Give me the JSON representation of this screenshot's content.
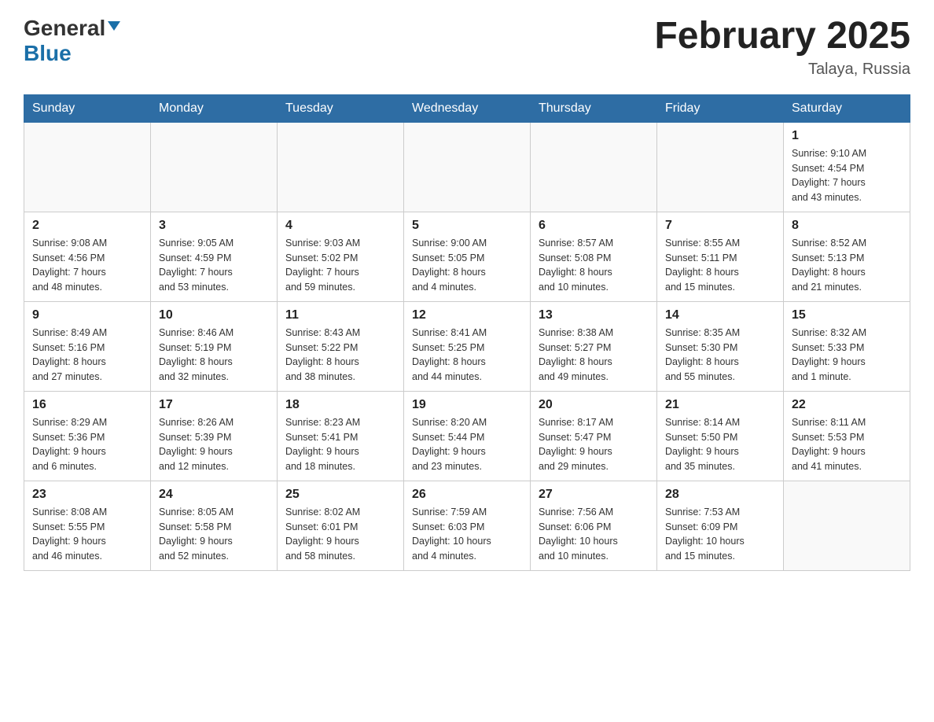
{
  "header": {
    "logo": {
      "general": "General",
      "blue": "Blue",
      "triangle": true
    },
    "title": "February 2025",
    "location": "Talaya, Russia"
  },
  "days_of_week": [
    "Sunday",
    "Monday",
    "Tuesday",
    "Wednesday",
    "Thursday",
    "Friday",
    "Saturday"
  ],
  "weeks": [
    [
      {
        "day": "",
        "info": ""
      },
      {
        "day": "",
        "info": ""
      },
      {
        "day": "",
        "info": ""
      },
      {
        "day": "",
        "info": ""
      },
      {
        "day": "",
        "info": ""
      },
      {
        "day": "",
        "info": ""
      },
      {
        "day": "1",
        "info": "Sunrise: 9:10 AM\nSunset: 4:54 PM\nDaylight: 7 hours\nand 43 minutes."
      }
    ],
    [
      {
        "day": "2",
        "info": "Sunrise: 9:08 AM\nSunset: 4:56 PM\nDaylight: 7 hours\nand 48 minutes."
      },
      {
        "day": "3",
        "info": "Sunrise: 9:05 AM\nSunset: 4:59 PM\nDaylight: 7 hours\nand 53 minutes."
      },
      {
        "day": "4",
        "info": "Sunrise: 9:03 AM\nSunset: 5:02 PM\nDaylight: 7 hours\nand 59 minutes."
      },
      {
        "day": "5",
        "info": "Sunrise: 9:00 AM\nSunset: 5:05 PM\nDaylight: 8 hours\nand 4 minutes."
      },
      {
        "day": "6",
        "info": "Sunrise: 8:57 AM\nSunset: 5:08 PM\nDaylight: 8 hours\nand 10 minutes."
      },
      {
        "day": "7",
        "info": "Sunrise: 8:55 AM\nSunset: 5:11 PM\nDaylight: 8 hours\nand 15 minutes."
      },
      {
        "day": "8",
        "info": "Sunrise: 8:52 AM\nSunset: 5:13 PM\nDaylight: 8 hours\nand 21 minutes."
      }
    ],
    [
      {
        "day": "9",
        "info": "Sunrise: 8:49 AM\nSunset: 5:16 PM\nDaylight: 8 hours\nand 27 minutes."
      },
      {
        "day": "10",
        "info": "Sunrise: 8:46 AM\nSunset: 5:19 PM\nDaylight: 8 hours\nand 32 minutes."
      },
      {
        "day": "11",
        "info": "Sunrise: 8:43 AM\nSunset: 5:22 PM\nDaylight: 8 hours\nand 38 minutes."
      },
      {
        "day": "12",
        "info": "Sunrise: 8:41 AM\nSunset: 5:25 PM\nDaylight: 8 hours\nand 44 minutes."
      },
      {
        "day": "13",
        "info": "Sunrise: 8:38 AM\nSunset: 5:27 PM\nDaylight: 8 hours\nand 49 minutes."
      },
      {
        "day": "14",
        "info": "Sunrise: 8:35 AM\nSunset: 5:30 PM\nDaylight: 8 hours\nand 55 minutes."
      },
      {
        "day": "15",
        "info": "Sunrise: 8:32 AM\nSunset: 5:33 PM\nDaylight: 9 hours\nand 1 minute."
      }
    ],
    [
      {
        "day": "16",
        "info": "Sunrise: 8:29 AM\nSunset: 5:36 PM\nDaylight: 9 hours\nand 6 minutes."
      },
      {
        "day": "17",
        "info": "Sunrise: 8:26 AM\nSunset: 5:39 PM\nDaylight: 9 hours\nand 12 minutes."
      },
      {
        "day": "18",
        "info": "Sunrise: 8:23 AM\nSunset: 5:41 PM\nDaylight: 9 hours\nand 18 minutes."
      },
      {
        "day": "19",
        "info": "Sunrise: 8:20 AM\nSunset: 5:44 PM\nDaylight: 9 hours\nand 23 minutes."
      },
      {
        "day": "20",
        "info": "Sunrise: 8:17 AM\nSunset: 5:47 PM\nDaylight: 9 hours\nand 29 minutes."
      },
      {
        "day": "21",
        "info": "Sunrise: 8:14 AM\nSunset: 5:50 PM\nDaylight: 9 hours\nand 35 minutes."
      },
      {
        "day": "22",
        "info": "Sunrise: 8:11 AM\nSunset: 5:53 PM\nDaylight: 9 hours\nand 41 minutes."
      }
    ],
    [
      {
        "day": "23",
        "info": "Sunrise: 8:08 AM\nSunset: 5:55 PM\nDaylight: 9 hours\nand 46 minutes."
      },
      {
        "day": "24",
        "info": "Sunrise: 8:05 AM\nSunset: 5:58 PM\nDaylight: 9 hours\nand 52 minutes."
      },
      {
        "day": "25",
        "info": "Sunrise: 8:02 AM\nSunset: 6:01 PM\nDaylight: 9 hours\nand 58 minutes."
      },
      {
        "day": "26",
        "info": "Sunrise: 7:59 AM\nSunset: 6:03 PM\nDaylight: 10 hours\nand 4 minutes."
      },
      {
        "day": "27",
        "info": "Sunrise: 7:56 AM\nSunset: 6:06 PM\nDaylight: 10 hours\nand 10 minutes."
      },
      {
        "day": "28",
        "info": "Sunrise: 7:53 AM\nSunset: 6:09 PM\nDaylight: 10 hours\nand 15 minutes."
      },
      {
        "day": "",
        "info": ""
      }
    ]
  ]
}
